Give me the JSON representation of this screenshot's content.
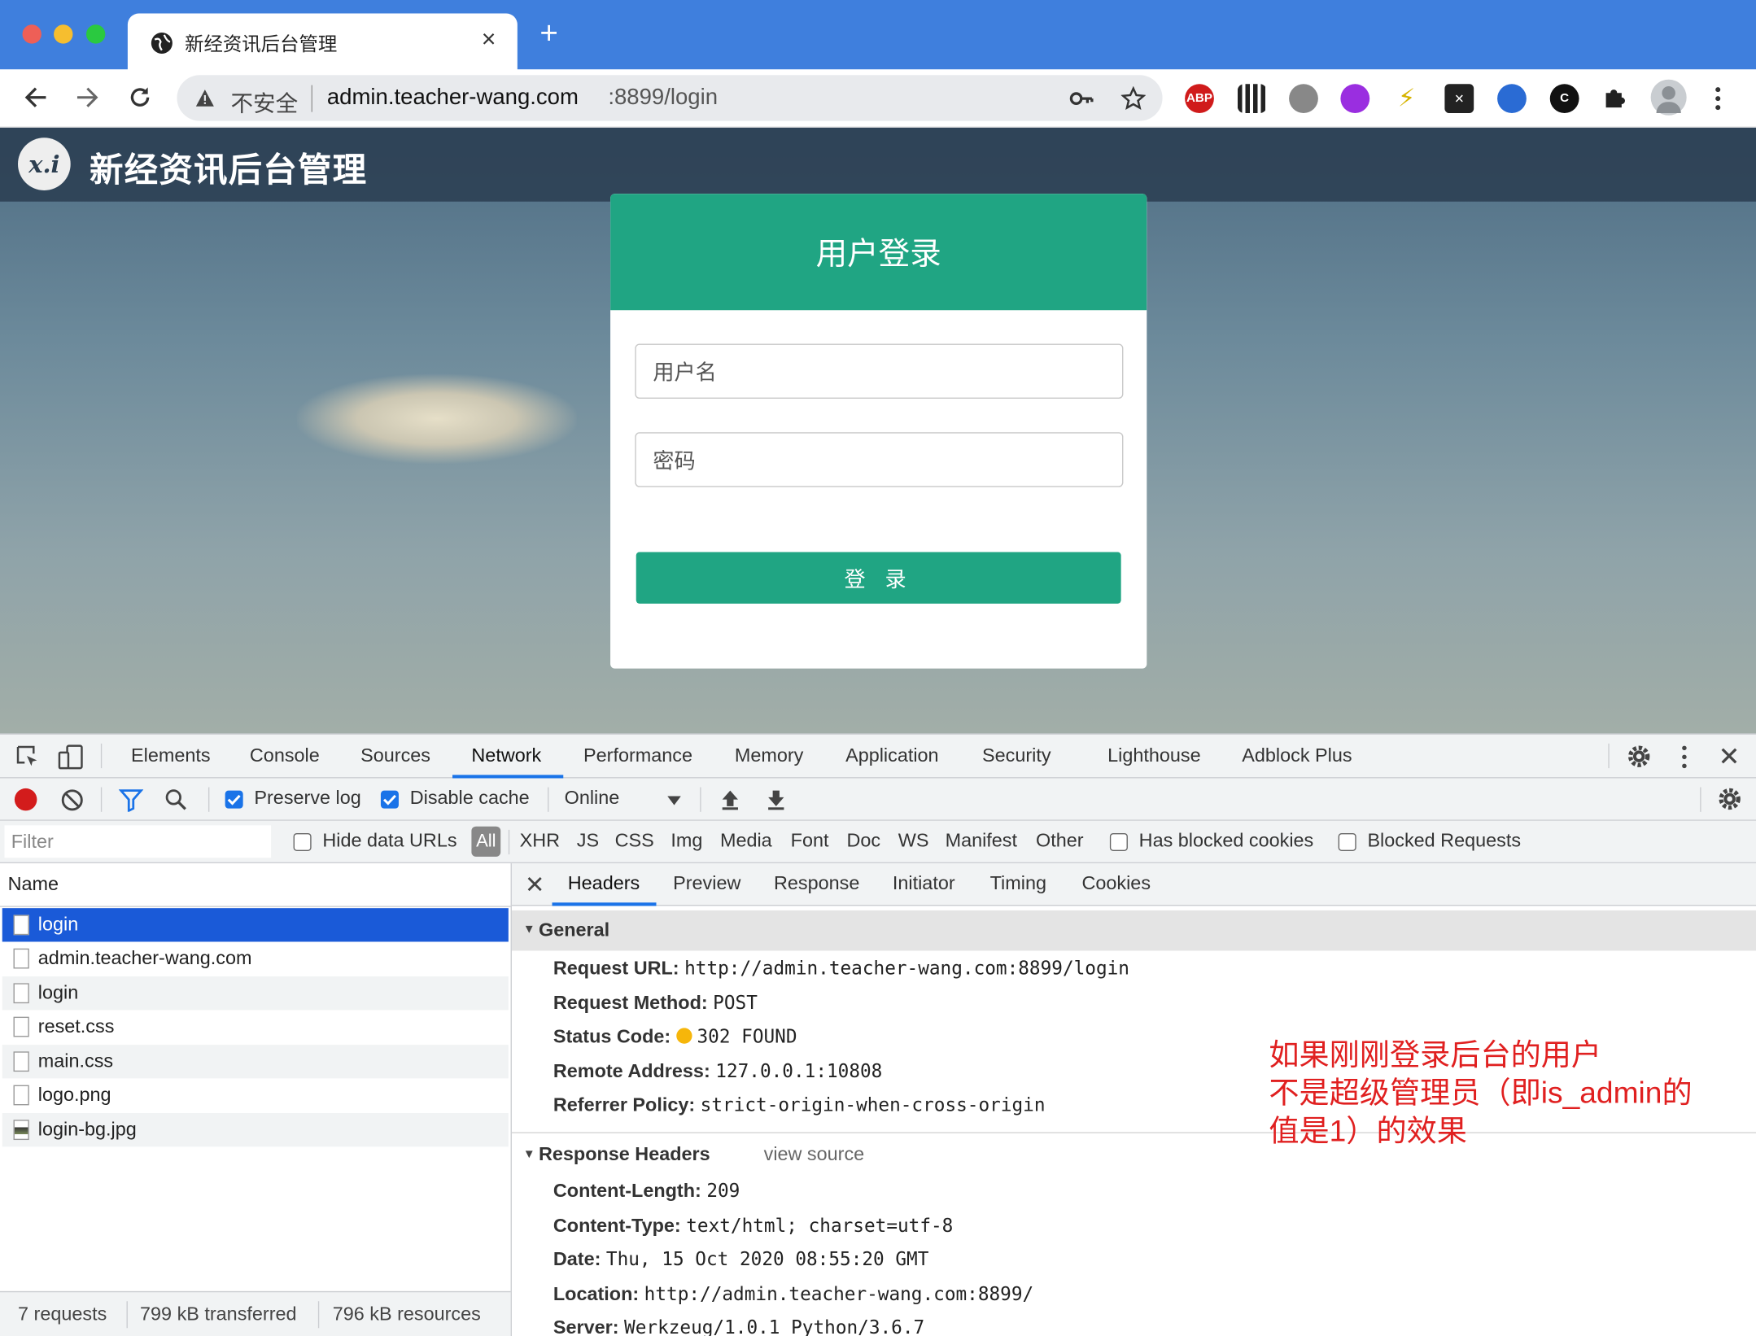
{
  "tab": {
    "title": "新经资讯后台管理",
    "close": "×",
    "new_tab": "+"
  },
  "omnibox": {
    "security_label": "不安全",
    "url_host": "admin.teacher-wang.com",
    "url_rest": ":8899/login"
  },
  "extensions": {
    "abp": "ABP"
  },
  "site": {
    "logo_text": "x.i",
    "title": "新经资讯后台管理"
  },
  "login": {
    "heading": "用户登录",
    "username_placeholder": "用户名",
    "password_placeholder": "密码",
    "submit": "登 录"
  },
  "devtools": {
    "tabs": [
      "Elements",
      "Console",
      "Sources",
      "Network",
      "Performance",
      "Memory",
      "Application",
      "Security",
      "Lighthouse",
      "Adblock Plus"
    ],
    "active_tab": "Network",
    "toolbar": {
      "preserve_log": "Preserve log",
      "disable_cache": "Disable cache",
      "throttle": "Online"
    },
    "filter": {
      "placeholder": "Filter",
      "hide_data_urls": "Hide data URLs",
      "types": [
        "All",
        "XHR",
        "JS",
        "CSS",
        "Img",
        "Media",
        "Font",
        "Doc",
        "WS",
        "Manifest",
        "Other"
      ],
      "has_blocked_cookies": "Has blocked cookies",
      "blocked_requests": "Blocked Requests"
    },
    "list": {
      "header": "Name",
      "rows": [
        "login",
        "admin.teacher-wang.com",
        "login",
        "reset.css",
        "main.css",
        "logo.png",
        "login-bg.jpg"
      ],
      "status": {
        "requests": "7 requests",
        "transferred": "799 kB transferred",
        "resources": "796 kB resources"
      }
    },
    "detail_tabs": [
      "Headers",
      "Preview",
      "Response",
      "Initiator",
      "Timing",
      "Cookies"
    ],
    "general": {
      "title": "General",
      "request_url_k": "Request URL:",
      "request_url_v": "http://admin.teacher-wang.com:8899/login",
      "method_k": "Request Method:",
      "method_v": "POST",
      "status_k": "Status Code:",
      "status_v": "302 FOUND",
      "remote_k": "Remote Address:",
      "remote_v": "127.0.0.1:10808",
      "referrer_k": "Referrer Policy:",
      "referrer_v": "strict-origin-when-cross-origin"
    },
    "response": {
      "title": "Response Headers",
      "view_source": "view source",
      "length_k": "Content-Length:",
      "length_v": "209",
      "type_k": "Content-Type:",
      "type_v": "text/html; charset=utf-8",
      "date_k": "Date:",
      "date_v": "Thu, 15 Oct 2020 08:55:20 GMT",
      "location_k": "Location:",
      "location_v": "http://admin.teacher-wang.com:8899/",
      "server_k": "Server:",
      "server_v": "Werkzeug/1.0.1 Python/3.6.7"
    }
  },
  "annotation": {
    "line1": "如果刚刚登录后台的用户",
    "line2": "不是超级管理员（即is_admin的",
    "line3": "值是1）的效果"
  },
  "colors": {
    "tabstrip": "#3f7fdd",
    "accent_green": "#20a583",
    "selected_row": "#1a5ad8",
    "annotation": "#e02020"
  }
}
